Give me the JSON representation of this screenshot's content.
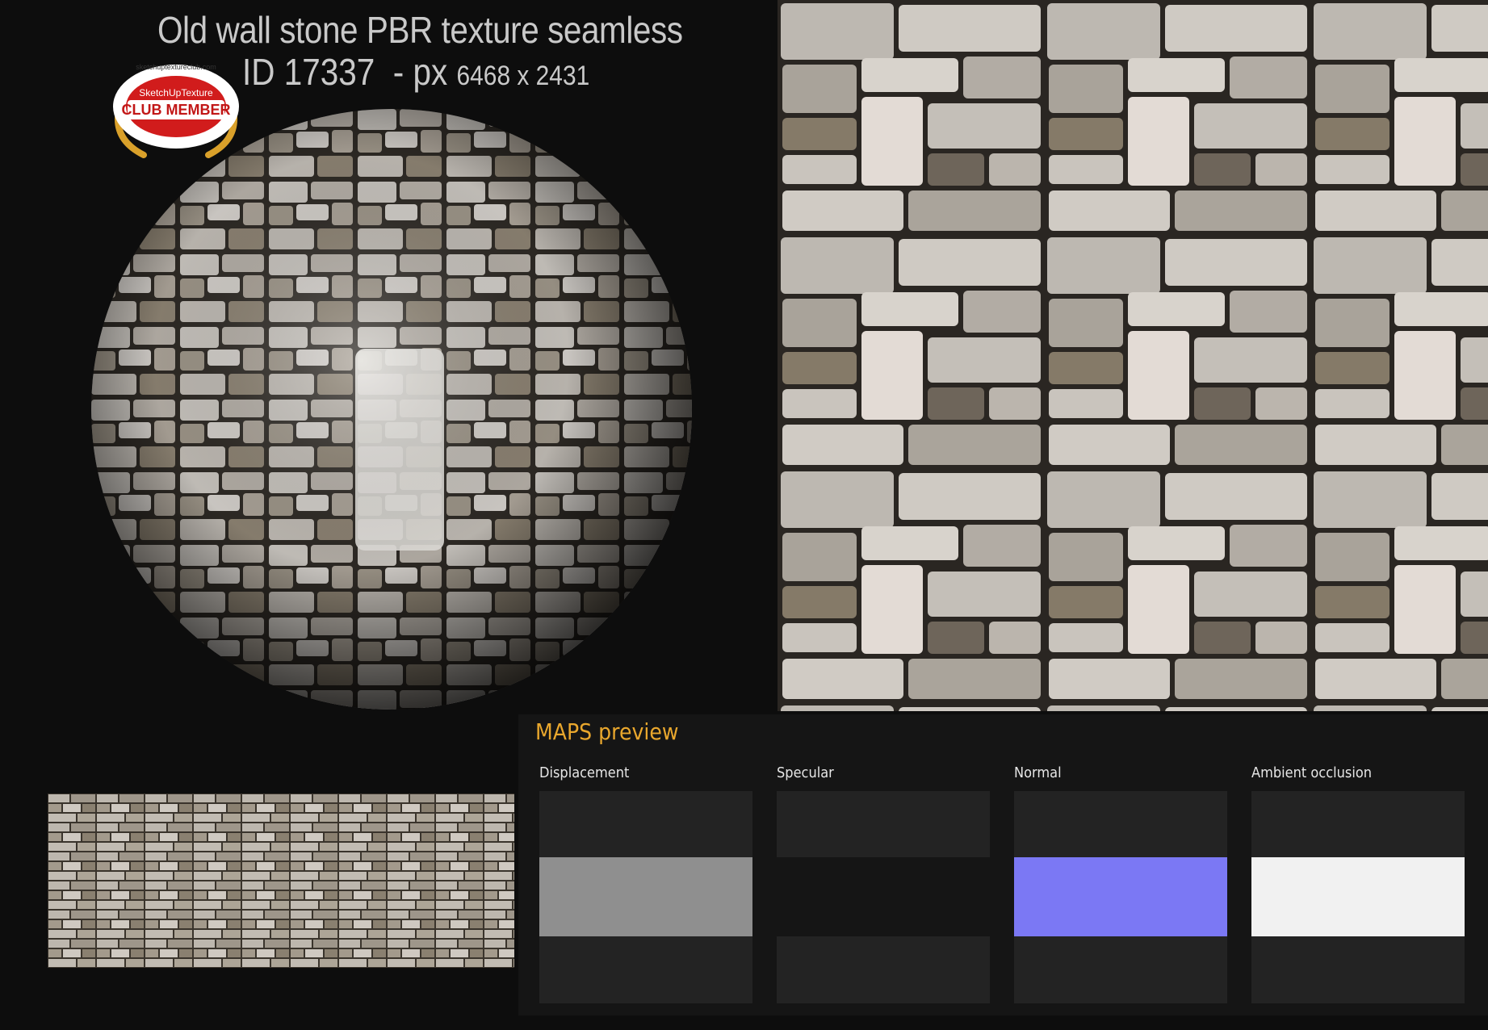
{
  "title": {
    "line1": "Old wall stone PBR texture seamless",
    "id_text": "ID 17337",
    "px_prefix": "  - px ",
    "dimensions": "6468 x 2431"
  },
  "badge": {
    "top_text": "SketchUpTexture",
    "main_text": "CLUB MEMBER",
    "ring_text": "sketchuptextureclub.com"
  },
  "maps": {
    "heading": "MAPS preview",
    "items": [
      {
        "label": "Displacement",
        "color": "#8f8f8f"
      },
      {
        "label": "Specular",
        "color": "#151515"
      },
      {
        "label": "Normal",
        "color": "#7b78f4"
      },
      {
        "label": "Ambient occlusion",
        "color": "#f1f1f1"
      }
    ]
  },
  "colors": {
    "background": "#0d0d0d",
    "accent": "#e9a72d",
    "panel": "#151515",
    "map_box": "#232323"
  }
}
